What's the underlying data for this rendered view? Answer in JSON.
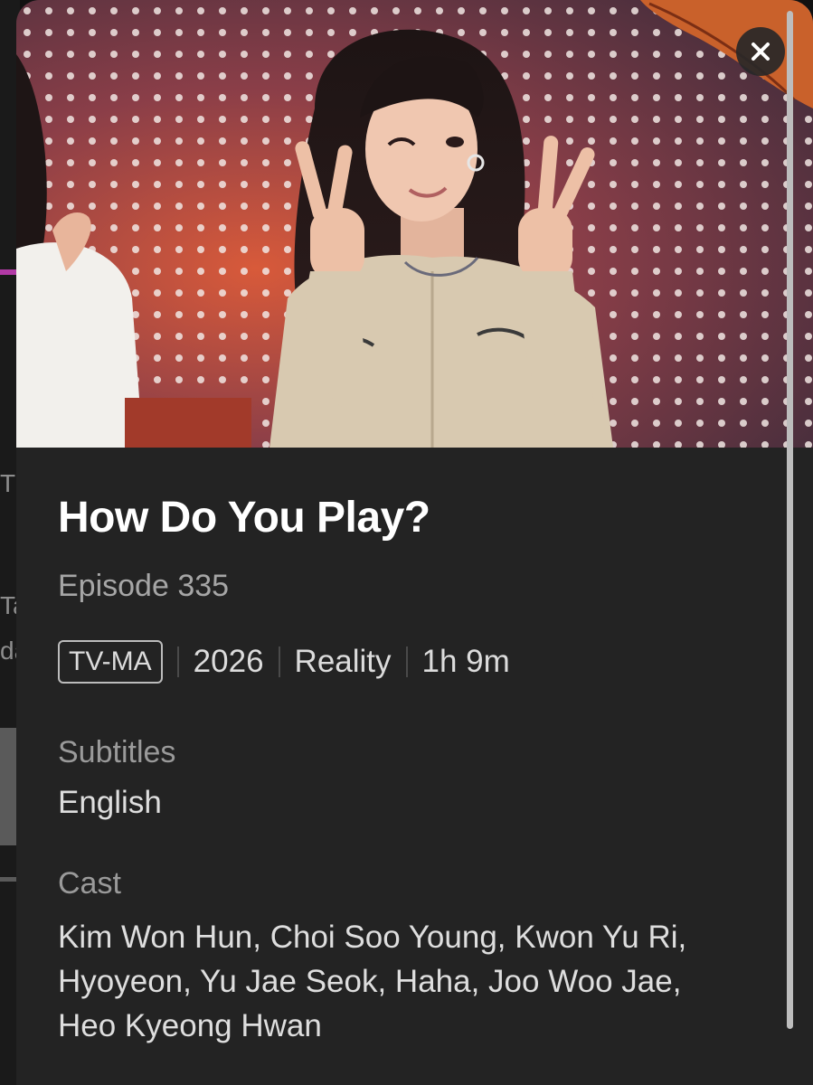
{
  "show": {
    "title": "How Do You Play?",
    "episode": "Episode 335",
    "rating": "TV-MA",
    "year": "2026",
    "genre": "Reality",
    "duration": "1h 9m"
  },
  "sections": {
    "subtitles_label": "Subtitles",
    "subtitles_value": "English",
    "cast_label": "Cast",
    "cast_line1": "Kim Won Hun, Choi Soo Young, Kwon Yu Ri,",
    "cast_line2": "Hyoyeon, Yu Jae Seok, Haha, Joo Woo Jae,",
    "cast_line3": "Heo Kyeong Hwan"
  },
  "background_peek": {
    "letters": [
      "T",
      "Ta",
      "da"
    ]
  },
  "icons": {
    "close": "close-icon"
  },
  "colors": {
    "modal_bg": "#232323",
    "accent": "#b23aa6",
    "title": "#ffffff",
    "muted": "#a6a6a6"
  }
}
